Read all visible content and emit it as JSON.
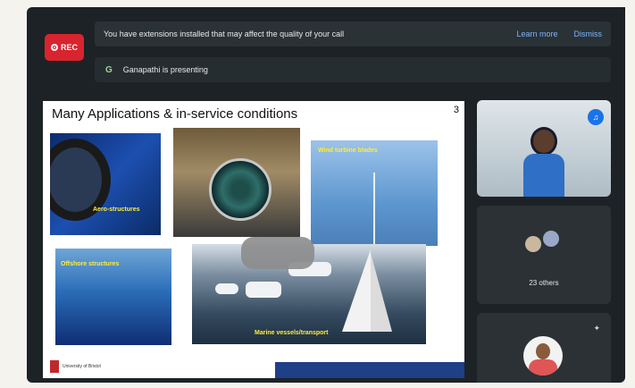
{
  "recording": {
    "label": "REC"
  },
  "banner": {
    "message": "You have extensions installed that may affect the quality of your call",
    "learn_more": "Learn more",
    "dismiss": "Dismiss"
  },
  "presenting": {
    "icon": "G",
    "text": "Ganapathi is presenting"
  },
  "slide": {
    "title": "Many Applications & in-service conditions",
    "page_number": "3",
    "captions": {
      "aero": "Aero-structures",
      "wind": "Wind turbine blades",
      "offshore": "Offshore structures",
      "marine": "Marine vessels/transport"
    },
    "logo_text": "University of Bristol"
  },
  "participants": {
    "others_label": "23 others"
  },
  "colors": {
    "rec_red": "#d8242e",
    "link_blue": "#7fb4ff",
    "caption_yellow": "#ffec3b",
    "mic_blue": "#1a73e8"
  },
  "icons": [
    "record-icon",
    "mic-active-icon",
    "pin-icon",
    "presenting-icon"
  ]
}
